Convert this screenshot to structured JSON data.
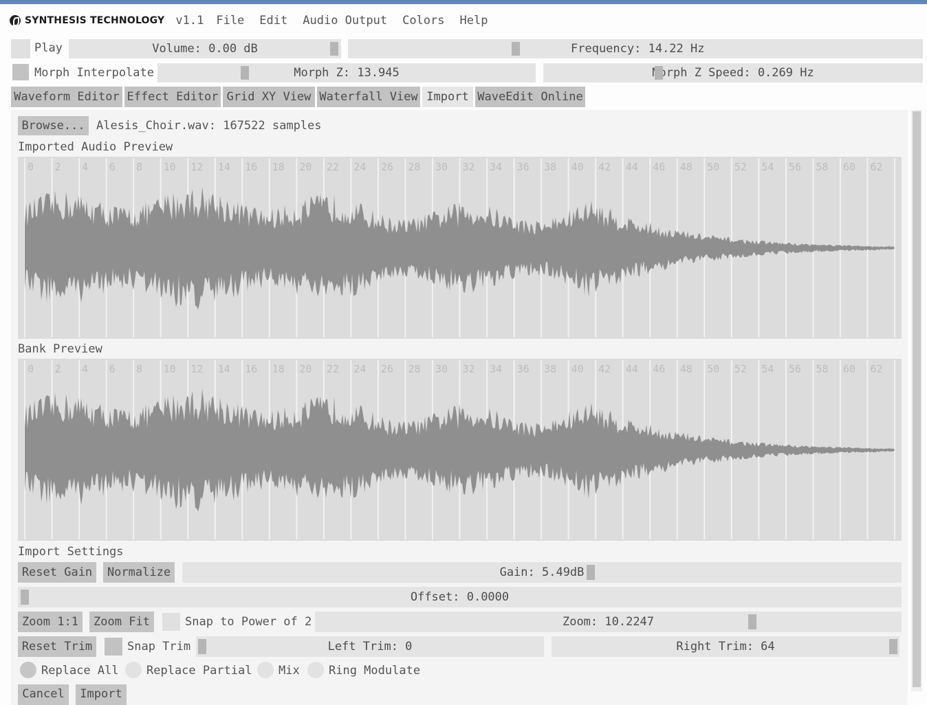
{
  "app": {
    "brand": "SYNTHESIS TECHNOLOGY",
    "version": "v1.1",
    "menu": [
      "File",
      "Edit",
      "Audio Output",
      "Colors",
      "Help"
    ]
  },
  "controls": {
    "play_label": "Play",
    "volume": "Volume: 0.00 dB",
    "frequency": "Frequency: 14.22 Hz",
    "morph_interpolate_label": "Morph Interpolate",
    "morph_z": "Morph Z: 13.945",
    "morph_z_speed": "Morph Z Speed: 0.269 Hz"
  },
  "tabs": [
    {
      "label": "Waveform Editor",
      "active": false
    },
    {
      "label": "Effect Editor",
      "active": false
    },
    {
      "label": "Grid XY View",
      "active": false
    },
    {
      "label": "Waterfall View",
      "active": false
    },
    {
      "label": "Import",
      "active": true
    },
    {
      "label": "WaveEdit Online",
      "active": false
    }
  ],
  "import": {
    "browse_label": "Browse...",
    "file_info": "Alesis_Choir.wav: 167522 samples",
    "imported_preview_label": "Imported Audio Preview",
    "bank_preview_label": "Bank Preview",
    "ticks": [
      "0",
      "2",
      "4",
      "6",
      "8",
      "10",
      "12",
      "14",
      "16",
      "18",
      "20",
      "22",
      "24",
      "26",
      "28",
      "30",
      "32",
      "34",
      "36",
      "38",
      "40",
      "42",
      "44",
      "46",
      "48",
      "50",
      "52",
      "54",
      "56",
      "58",
      "60",
      "62"
    ],
    "settings_label": "Import Settings",
    "reset_gain_label": "Reset Gain",
    "normalize_label": "Normalize",
    "gain": "Gain: 5.49dB",
    "offset": "Offset: 0.0000",
    "zoom_1_1_label": "Zoom 1:1",
    "zoom_fit_label": "Zoom Fit",
    "snap_power_label": "Snap to Power of 2",
    "zoom": "Zoom: 10.2247",
    "reset_trim_label": "Reset Trim",
    "snap_trim_label": "Snap Trim",
    "left_trim": "Left Trim: 0",
    "right_trim": "Right Trim: 64",
    "modes": [
      "Replace All",
      "Replace Partial",
      "Mix",
      "Ring Modulate"
    ],
    "selected_mode": "Replace All",
    "cancel_label": "Cancel",
    "import_label": "Import"
  },
  "colors": {
    "waveform": "#8f8f8f",
    "accent_bar": "#5e88b8"
  }
}
